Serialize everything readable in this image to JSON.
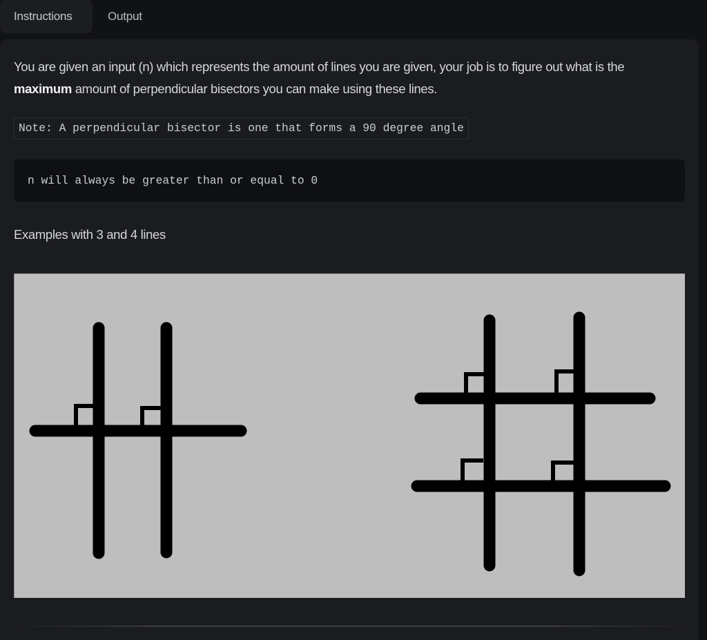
{
  "tabs": [
    {
      "label": "Instructions",
      "active": true
    },
    {
      "label": "Output",
      "active": false
    }
  ],
  "description": {
    "before_bold": "You are given an input (n) which represents the amount of lines you are given, your job is to figure out what is the ",
    "bold": "maximum",
    "after_bold": " amount of perpendicular bisectors you can make using these lines."
  },
  "note": "Note: A perpendicular bisector is one that forms a 90 degree angle",
  "code_block": "n will always be greater than or equal to 0",
  "examples_heading": "Examples with 3 and 4 lines",
  "figure": {
    "background_color": "#bebebe",
    "line_color": "#000000",
    "examples": [
      {
        "name": "three-lines",
        "vertical_lines": 2,
        "horizontal_lines": 1,
        "right_angles": 2
      },
      {
        "name": "four-lines",
        "vertical_lines": 2,
        "horizontal_lines": 2,
        "right_angles": 4
      }
    ]
  }
}
